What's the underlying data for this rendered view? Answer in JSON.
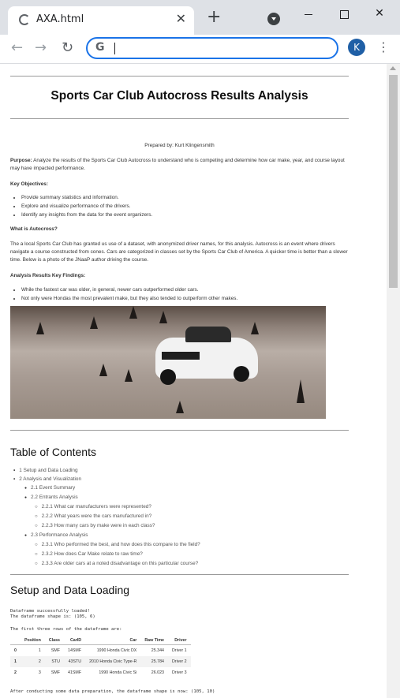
{
  "browser": {
    "tab_title": "AXA.html",
    "tab_close": "✕",
    "new_tab": "+",
    "omnibox_icon": "G",
    "omnibox_value": "",
    "avatar_letter": "K",
    "menu": "⋮",
    "back": "←",
    "forward": "→",
    "reload": "↻"
  },
  "report": {
    "title": "Sports Car Club Autocross Results Analysis",
    "prepared_by": "Prepared by: Kurt Klingensmith",
    "purpose_label": "Purpose:",
    "purpose_text": " Analyze the results of the Sports Car Club Autocross to understand who is competing and determine how car make, year, and course layout may have impacted performance.",
    "objectives_heading": "Key Objectives:",
    "objectives": [
      "Provide summary statistics and information.",
      "Explore and visualize performance of the drivers.",
      "Identify any insights from the data for the event organizers."
    ],
    "what_heading": "What is Autocross?",
    "what_text": "The a local Sports Car Club has granted us use of a dataset, with anonymized driver names, for this analysis. Autocross is an event where drivers navigate a course constructed from cones. Cars are categorized in classes set by the Sports Car Club of America. A quicker time is better than a slower time. Below is a photo of the JNaaP author driving the course.",
    "findings_heading": "Analysis Results Key Findings:",
    "findings": [
      "While the fastest car was older, in general, newer cars outperformed older cars.",
      "Not only were Hondas the most prevalent make, but they also tended to outperform other makes."
    ]
  },
  "toc": {
    "heading": "Table of Contents",
    "items": [
      {
        "level": 1,
        "text": "1  Setup and Data Loading"
      },
      {
        "level": 1,
        "text": "2  Analysis and Visualization"
      },
      {
        "level": 2,
        "text": "2.1  Event Summary"
      },
      {
        "level": 2,
        "text": "2.2  Entrants Analysis"
      },
      {
        "level": 3,
        "text": "2.2.1  What car manufacturers were represented?"
      },
      {
        "level": 3,
        "text": "2.2.2  What years were the cars manufactured in?"
      },
      {
        "level": 3,
        "text": "2.2.3  How many cars by make were in each class?"
      },
      {
        "level": 2,
        "text": "2.3  Performance Analysis"
      },
      {
        "level": 3,
        "text": "2.3.1  Who performed the best, and how does this compare to the field?"
      },
      {
        "level": 3,
        "text": "2.3.2  How does Car Make relate to raw time?"
      },
      {
        "level": 3,
        "text": "2.3.3  Are older cars at a noted disadvantage on this particular course?"
      }
    ]
  },
  "setup": {
    "heading": "Setup and Data Loading",
    "output_line1": "Dataframe successfully loaded!",
    "output_line2": "The dataframe shape is: (105, 6)",
    "output_line3": "The first three rows of the dataframe are:",
    "table": {
      "columns": [
        "",
        "Position",
        "Class",
        "CarID",
        "Car",
        "Raw Time",
        "Driver"
      ],
      "rows": [
        [
          "0",
          "1",
          "SMF",
          "14SMF",
          "1990 Honda Civic DX",
          "25.344",
          "Driver 1"
        ],
        [
          "1",
          "2",
          "STU",
          "43STU",
          "2010 Honda Civic Type-R",
          "25.784",
          "Driver 2"
        ],
        [
          "2",
          "3",
          "SMF",
          "41SMF",
          "1990 Honda Civic Si",
          "26.023",
          "Driver 3"
        ]
      ]
    },
    "output_line4": "After conducting some data preparation, the dataframe shape is now: (105, 10)"
  }
}
